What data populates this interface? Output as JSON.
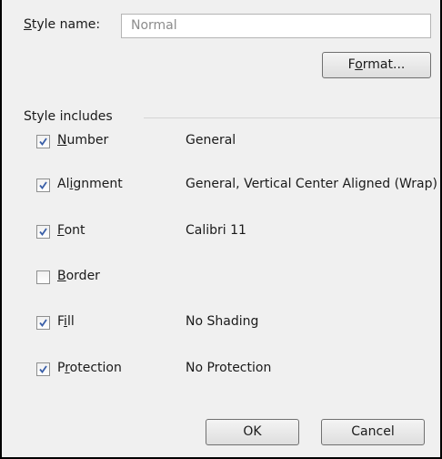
{
  "style_name": {
    "label": "Style name:",
    "value": "Normal"
  },
  "format_button": "Format...",
  "includes_heading": "Style includes",
  "options": [
    {
      "label": "Number",
      "checked": true,
      "description": "General"
    },
    {
      "label": "Alignment",
      "checked": true,
      "description": "General, Vertical Center Aligned (Wrap)"
    },
    {
      "label": "Font",
      "checked": true,
      "description": "Calibri 11"
    },
    {
      "label": "Border",
      "checked": false,
      "description": ""
    },
    {
      "label": "Fill",
      "checked": true,
      "description": "No Shading"
    },
    {
      "label": "Protection",
      "checked": true,
      "description": "No Protection"
    }
  ],
  "ok_button": "OK",
  "cancel_button": "Cancel",
  "colors": {
    "checkmark": "#3a5fa8",
    "dialog_background": "#f0f0f0"
  }
}
